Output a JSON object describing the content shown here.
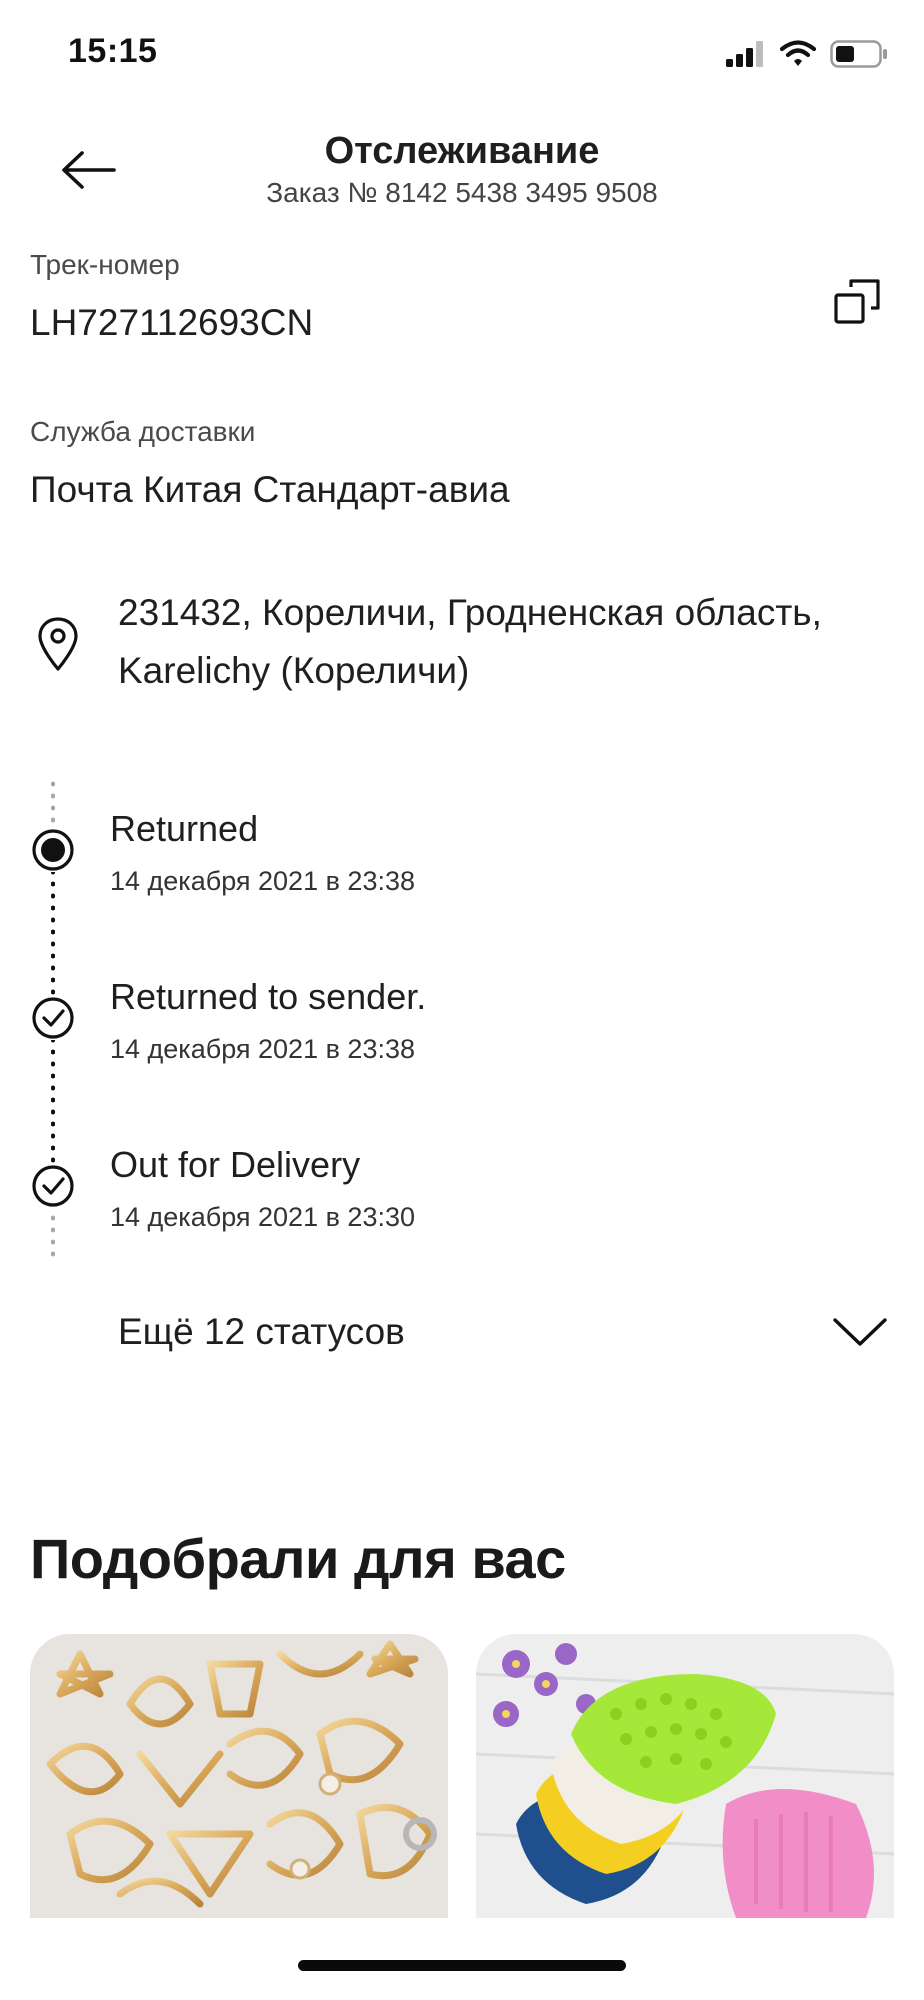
{
  "status_bar": {
    "time": "15:15",
    "icons": [
      "signal-icon",
      "wifi-icon",
      "battery-icon"
    ]
  },
  "header": {
    "title": "Отслеживание",
    "subtitle": "Заказ № 8142 5438 3495 9508"
  },
  "tracking": {
    "label": "Трек-номер",
    "number": "LH727112693CN"
  },
  "delivery": {
    "label": "Служба доставки",
    "service": "Почта Китая Стандарт-авиа"
  },
  "address": {
    "line1": "231432, Кореличи, Гродненская область,",
    "line2": "Karelichy (Кореличи)"
  },
  "timeline": [
    {
      "status": "Returned",
      "date": "14 декабря 2021 в 23:38"
    },
    {
      "status": "Returned to sender.",
      "date": "14 декабря 2021 в 23:38"
    },
    {
      "status": "Out for Delivery",
      "date": "14 декабря 2021 в 23:30"
    }
  ],
  "more_statuses": {
    "label": "Ещё 12 статусов"
  },
  "recommendations": {
    "title": "Подобрали для вас"
  },
  "colors": {
    "text_primary": "#1f1f1f",
    "text_secondary": "#4a4a4a",
    "accent_green": "#a5e83a",
    "accent_pink": "#f28ec7"
  }
}
